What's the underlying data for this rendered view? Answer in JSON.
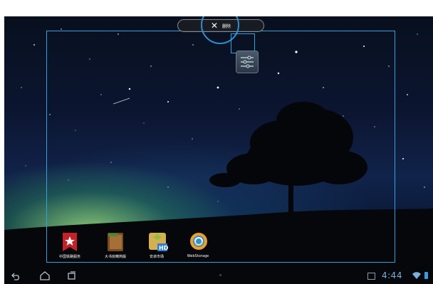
{
  "delete_bar": {
    "close_icon": "close-x",
    "label": "删除"
  },
  "widget": {
    "icon": "settings-sliders"
  },
  "apps": [
    {
      "label": "中国铁路服务",
      "icon": "star-bookmark",
      "color": "#c62128"
    },
    {
      "label": "大书房精简版",
      "icon": "book",
      "color": "#8a5a2b"
    },
    {
      "label": "安卓市场",
      "icon": "market-hd",
      "color": "#c8a040"
    },
    {
      "label": "WebStorage",
      "icon": "cloud-sync",
      "color": "#f0a020"
    }
  ],
  "status": {
    "time": "4:44"
  },
  "nav": {
    "back": "back-icon",
    "home": "home-icon",
    "recent": "recent-apps-icon"
  }
}
